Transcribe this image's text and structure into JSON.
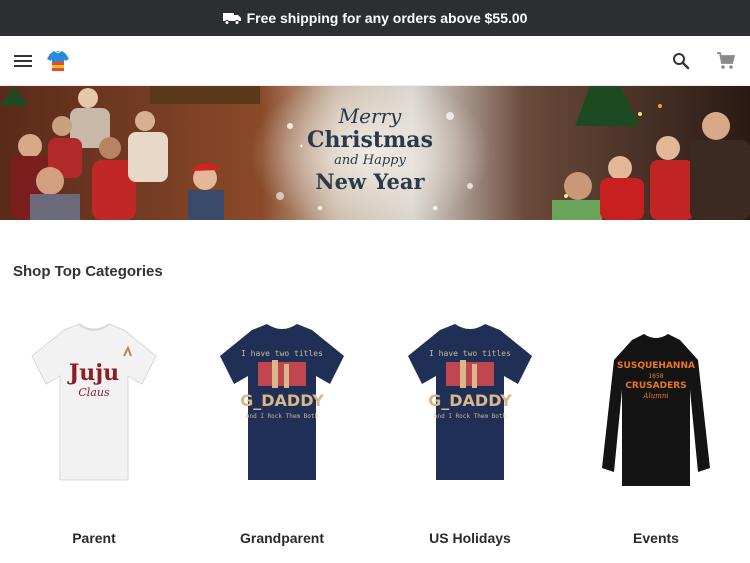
{
  "promo": {
    "text": "Free shipping for any orders above $55.00",
    "icon": "truck-icon"
  },
  "header": {
    "menu_icon": "menu-icon",
    "logo_icon": "tshirt-logo-icon",
    "search_icon": "search-icon",
    "cart_icon": "cart-icon"
  },
  "banner": {
    "line1": "Merry",
    "line2": "Christmas",
    "line3": "and Happy",
    "line4": "New Year"
  },
  "section": {
    "title": "Shop Top Categories"
  },
  "categories": [
    {
      "label": "Parent",
      "shirt_color": "#f2f2f2",
      "print": "Juju Claus"
    },
    {
      "label": "Grandparent",
      "shirt_color": "#1f2f55",
      "print": "G_DADDY"
    },
    {
      "label": "US Holidays",
      "shirt_color": "#1f2f55",
      "print": "G_DADDY"
    },
    {
      "label": "Events",
      "shirt_color": "#141414",
      "print": "SUSQUEHANNA CRUSADERS"
    }
  ],
  "colors": {
    "promo_bg": "#2b2f31",
    "accent_red": "#c0392b"
  }
}
